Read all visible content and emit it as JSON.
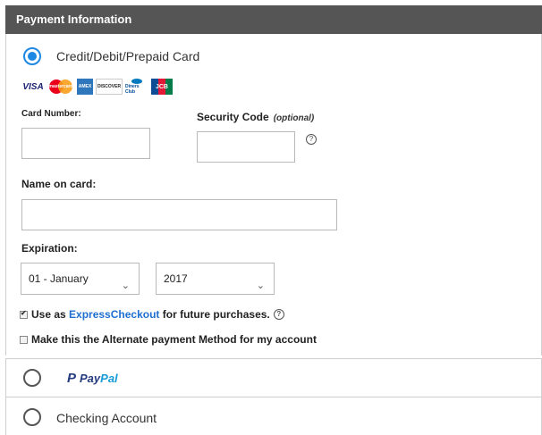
{
  "header": {
    "title": "Payment Information"
  },
  "card_option": {
    "label": "Credit/Debit/Prepaid Card",
    "selected": true,
    "logos": [
      "VISA",
      "mastercard",
      "AMEX",
      "DISCOVER",
      "Diners Club",
      "JCB"
    ]
  },
  "form": {
    "card_number_label": "Card Number:",
    "card_number_value": "",
    "security_code_label": "Security Code",
    "security_code_optional": "(optional)",
    "security_code_value": "",
    "help_icon_glyph": "?",
    "name_label": "Name on card:",
    "name_value": "",
    "expiration_label": "Expiration:",
    "month_selected": "01 - January",
    "year_selected": "2017",
    "chevron_glyph": "⌄"
  },
  "checkboxes": {
    "express_prefix": "Use as ",
    "express_link": "ExpressCheckout",
    "express_suffix": " for future purchases.",
    "express_checked": true,
    "alternate_label": "Make this the Alternate payment Method for my account",
    "alternate_checked": false
  },
  "paypal_option": {
    "label_pay": "Pay",
    "label_pal": "Pal",
    "selected": false
  },
  "checking_option": {
    "label": "Checking Account",
    "selected": false
  },
  "colors": {
    "header_bg": "#555555",
    "accent": "#1e88e5",
    "link": "#1e6fd0"
  }
}
